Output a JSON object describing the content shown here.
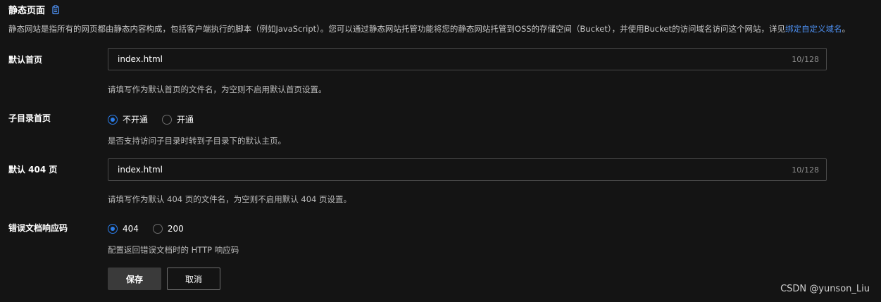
{
  "header": {
    "title": "静态页面",
    "copy_icon": "copy-icon",
    "description": "静态网站是指所有的网页都由静态内容构成，包括客户端执行的脚本（例如JavaScript）。您可以通过静态网站托管功能将您的静态网站托管到OSS的存储空间（Bucket），并使用Bucket的访问域名访问这个网站，详见",
    "link_text": "绑定自定义域名",
    "link_suffix": "。"
  },
  "default_index": {
    "label": "默认首页",
    "value": "index.html",
    "count": "10/128",
    "hint": "请填写作为默认首页的文件名，为空则不启用默认首页设置。"
  },
  "subdir_index": {
    "label": "子目录首页",
    "options": [
      "不开通",
      "开通"
    ],
    "selected": "不开通",
    "hint": "是否支持访问子目录时转到子目录下的默认主页。"
  },
  "default_404": {
    "label": "默认 404 页",
    "value": "index.html",
    "count": "10/128",
    "hint": "请填写作为默认 404 页的文件名，为空则不启用默认 404 页设置。"
  },
  "error_code": {
    "label": "错误文档响应码",
    "options": [
      "404",
      "200"
    ],
    "selected": "404",
    "hint": "配置返回错误文档时的 HTTP 响应码"
  },
  "actions": {
    "save": "保存",
    "cancel": "取消"
  },
  "watermark": "CSDN @yunson_Liu",
  "colors": {
    "background": "#141414",
    "accent": "#2b7de9",
    "link": "#4d8ff0",
    "border": "#4a4a4a"
  }
}
